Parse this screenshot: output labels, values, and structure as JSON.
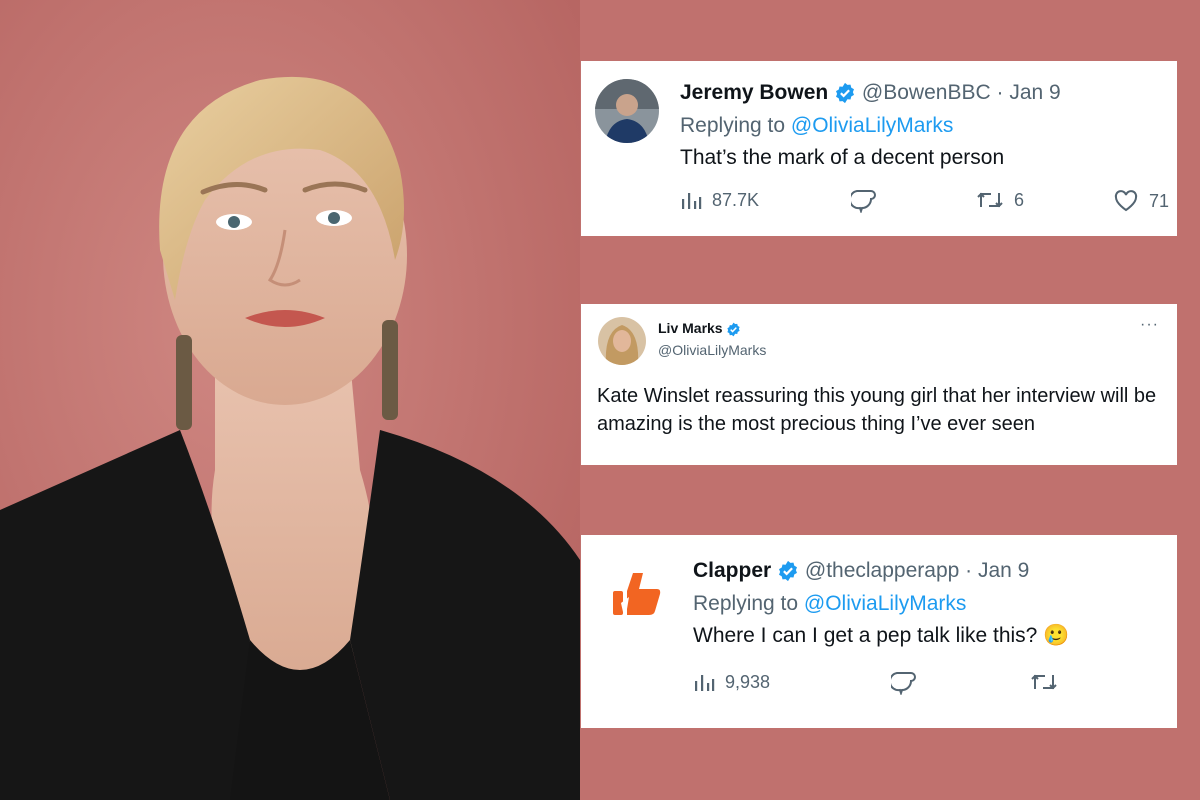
{
  "photo": {
    "alt": ""
  },
  "tweets": [
    {
      "name": "Jeremy Bowen",
      "handle": "@BowenBBC",
      "date": "Jan 9",
      "replying_prefix": "Replying to",
      "replying_to": "@OliviaLilyMarks",
      "text": "That’s the mark of a decent person",
      "views": "87.7K",
      "retweets": "6",
      "likes": "71"
    },
    {
      "name": "Liv Marks",
      "handle": "@OliviaLilyMarks",
      "more": "···",
      "text": "Kate Winslet reassuring this young girl that her interview will be amazing is the most precious thing I’ve ever seen"
    },
    {
      "name": "Clapper",
      "handle": "@theclapperapp",
      "date": "Jan 9",
      "replying_prefix": "Replying to",
      "replying_to": "@OliviaLilyMarks",
      "text": "Where I can I get a pep talk like this?",
      "emoji": "🥲",
      "views": "9,938"
    }
  ],
  "colors": {
    "background": "#c0716e",
    "verified": "#1d9bf0",
    "clapper_brand": "#f26522"
  }
}
